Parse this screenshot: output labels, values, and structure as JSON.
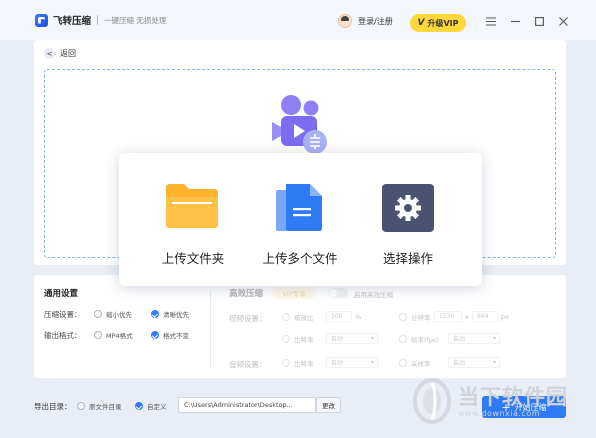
{
  "titlebar": {
    "app_name": "飞转压缩",
    "slogan": "一键压缩 无损处理",
    "login": "登录/注册",
    "vip_label": "升级VIP",
    "vip_icon": "V",
    "window_controls": [
      "menu-icon",
      "minimize-icon",
      "maximize-icon",
      "close-icon"
    ]
  },
  "nav": {
    "back_label": "返回",
    "back_icon": "<"
  },
  "upload_actions": [
    {
      "label": "上传文件夹",
      "icon": "folder-icon"
    },
    {
      "label": "上传多个文件",
      "icon": "files-icon"
    },
    {
      "label": "选择操作",
      "icon": "gear-icon"
    }
  ],
  "general_settings": {
    "title": "通用设置",
    "compress_label": "压缩设置：",
    "compress_options": [
      {
        "label": "缩小优先",
        "checked": false
      },
      {
        "label": "清晰优先",
        "checked": true
      }
    ],
    "format_label": "输出格式：",
    "format_options": [
      {
        "label": "MP4格式",
        "checked": false
      },
      {
        "label": "格式不变",
        "checked": true
      }
    ]
  },
  "advanced": {
    "title": "高效压缩",
    "vip_tag": "VIP专享",
    "toggle_label": "启用高效压缩",
    "video_label": "视频设置：",
    "audio_label": "音频设置：",
    "scale_label": "缩放比",
    "scale_value": "100",
    "scale_unit": "%",
    "resolution_label": "分辨率",
    "res_w": "1536",
    "res_x": "×",
    "res_h": "864",
    "res_unit": "px",
    "video_bitrate_label": "比特率",
    "video_bitrate_value": "自动",
    "fps_label": "帧率(fps)",
    "fps_value": "自动",
    "audio_bitrate_label": "比特率",
    "audio_bitrate_value": "自动",
    "sample_label": "采样率",
    "sample_value": "自动"
  },
  "output": {
    "label": "导出目录：",
    "options": [
      {
        "label": "原文件目录",
        "checked": false
      },
      {
        "label": "自定义",
        "checked": true
      }
    ],
    "path": "C:\\Users\\Administrator\\Desktop...",
    "change_label": "更改",
    "start_label": "开始压缩"
  },
  "watermark": {
    "cn": "当下软件园",
    "en": "www.downxia.com"
  },
  "colors": {
    "accent": "#2f7bf5",
    "vip": "#ffd93c",
    "folder": "#ffb22e",
    "files": "#2f7bf5",
    "gear_bg": "#4a5271",
    "video": "#7b6cf0"
  }
}
